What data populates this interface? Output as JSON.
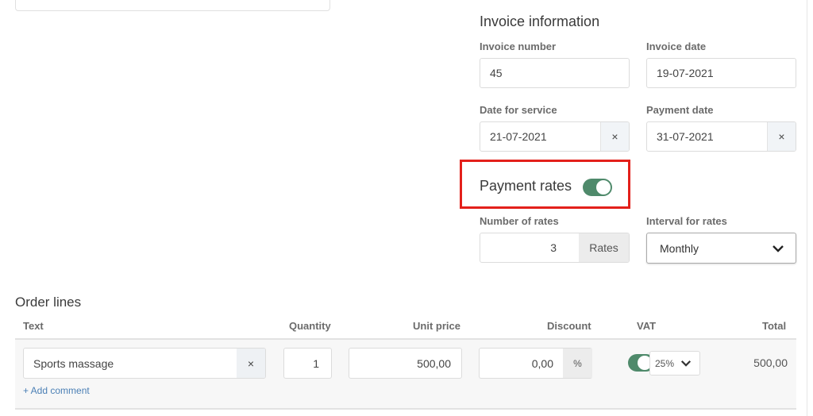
{
  "invoice_info": {
    "title": "Invoice information",
    "invoice_number": {
      "label": "Invoice number",
      "value": "45"
    },
    "invoice_date": {
      "label": "Invoice date",
      "value": "19-07-2021"
    },
    "date_for_service": {
      "label": "Date for service",
      "value": "21-07-2021",
      "clear_icon": "×"
    },
    "payment_date": {
      "label": "Payment date",
      "value": "31-07-2021",
      "clear_icon": "×"
    }
  },
  "payment_rates": {
    "title": "Payment rates",
    "enabled": true,
    "number_of_rates": {
      "label": "Number of rates",
      "value": "3",
      "unit": "Rates"
    },
    "interval": {
      "label": "Interval for rates",
      "value": "Monthly"
    },
    "highlight_color": "#e3201b"
  },
  "order_lines": {
    "title": "Order lines",
    "columns": [
      "Text",
      "Quantity",
      "Unit price",
      "Discount",
      "VAT",
      "Total"
    ],
    "rows": [
      {
        "text": "Sports massage",
        "clear_icon": "×",
        "quantity": "1",
        "unit_price": "500,00",
        "discount": "0,00",
        "discount_unit": "%",
        "vat_enabled": true,
        "vat": "25%",
        "total": "500,00",
        "add_comment": "+ Add comment"
      }
    ]
  },
  "colors": {
    "toggle_on": "#4f8a6b",
    "link": "#4a7fb5"
  }
}
